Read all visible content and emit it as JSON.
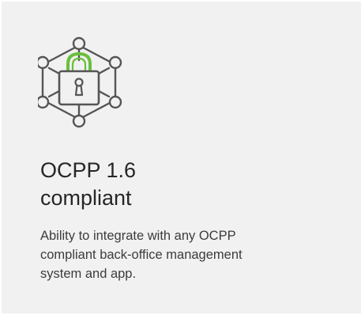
{
  "feature": {
    "icon": "network-padlock-icon",
    "title_lines": [
      "OCPP 1.6",
      "compliant"
    ],
    "description_lines": [
      "Ability to integrate with any OCPP",
      "compliant back-office management",
      "system and app."
    ]
  },
  "colors": {
    "card_background": "#f1f1f1",
    "icon_stroke": "#555555",
    "shackle_accent": "#6abf3b",
    "title_text": "#262626",
    "body_text": "#3c3c3c"
  }
}
